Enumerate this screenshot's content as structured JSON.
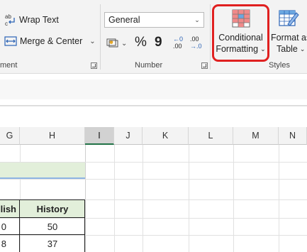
{
  "ribbon": {
    "alignment": {
      "wrap_text": "Wrap Text",
      "merge_center": "Merge & Center",
      "group_label": "ment"
    },
    "number": {
      "format_value": "General",
      "percent": "%",
      "comma": "9",
      "inc_decimal_top": "←0",
      "inc_decimal_bottom": ".00",
      "dec_decimal_top": ".00",
      "dec_decimal_bottom": "→.0",
      "group_label": "Number"
    },
    "styles": {
      "conditional_formatting_line1": "Conditional",
      "conditional_formatting_line2": "Formatting",
      "format_as_table_line1": "Format as",
      "format_as_table_line2": "Table",
      "group_label": "Styles"
    }
  },
  "columns": [
    "G",
    "H",
    "I",
    "J",
    "K",
    "L",
    "M",
    "N"
  ],
  "sheet": {
    "header_g": "lish",
    "header_h": "History",
    "rows": [
      {
        "g": "0",
        "h": "50"
      },
      {
        "g": "8",
        "h": "37"
      }
    ]
  },
  "colors": {
    "accent": "#217346",
    "highlight_box": "#e02020",
    "header_band": "#e2efda",
    "table_header_fill": "#e2efda"
  }
}
